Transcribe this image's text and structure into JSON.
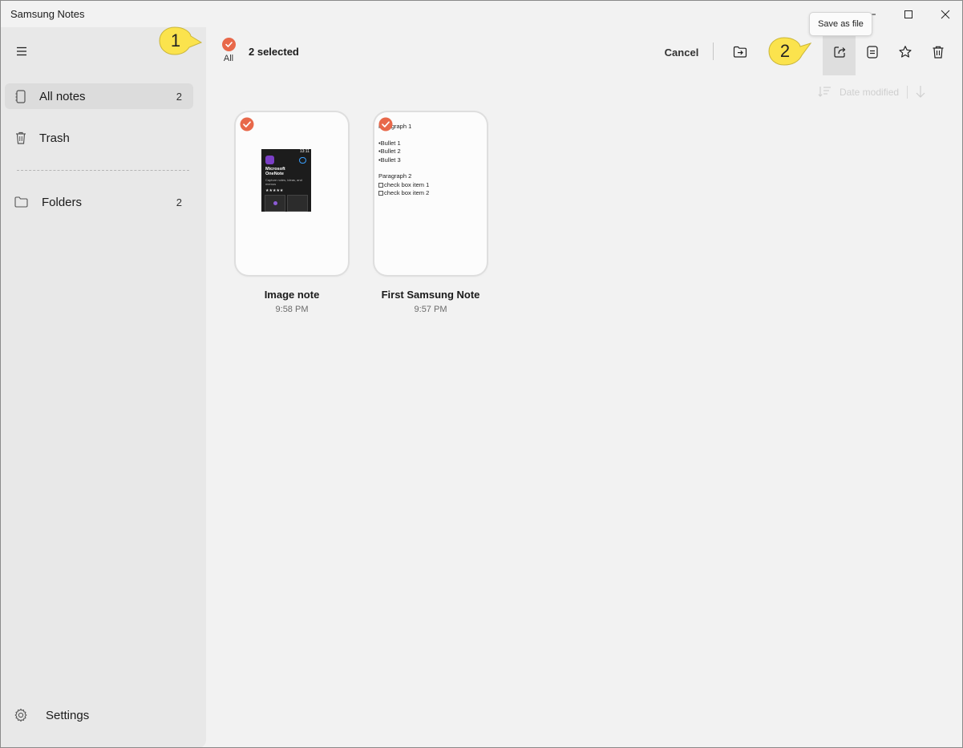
{
  "window": {
    "title": "Samsung Notes"
  },
  "sidebar": {
    "items": [
      {
        "label": "All notes",
        "count": "2",
        "icon": "notebook-icon"
      },
      {
        "label": "Trash",
        "count": "",
        "icon": "trash-icon"
      },
      {
        "label": "Folders",
        "count": "2",
        "icon": "folder-icon"
      }
    ],
    "settings_label": "Settings"
  },
  "selection": {
    "all_label": "All",
    "count_label": "2 selected"
  },
  "toolbar": {
    "cancel_label": "Cancel",
    "tooltip": "Save as file",
    "icons": [
      "move-to-folder-icon",
      "save-as-file-icon",
      "convert-note-icon",
      "favorite-star-icon",
      "delete-icon"
    ]
  },
  "sort": {
    "label": "Date modified"
  },
  "notes": [
    {
      "title": "Image note",
      "time": "9:58 PM",
      "thumb": {
        "clock": "13:11",
        "app_name_1": "Microsoft",
        "app_name_2": "OneNote",
        "desc": "Capture notes, ideas, and memos",
        "stars": "★★★★★"
      }
    },
    {
      "title": "First Samsung Note",
      "time": "9:57 PM",
      "preview": {
        "p1": "Paragraph 1",
        "b1": "•Bullet 1",
        "b2": "•Bullet 2",
        "b3": "•Bullet 3",
        "p2": "Paragraph 2",
        "c1": "check box item 1",
        "c2": "check box item 2"
      }
    }
  ],
  "callouts": {
    "one": "1",
    "two": "2"
  },
  "colors": {
    "accent": "#e8684a",
    "callout": "#fbe34d",
    "sidebar_bg": "#e8e8e8",
    "content_bg": "#f2f2f2"
  }
}
